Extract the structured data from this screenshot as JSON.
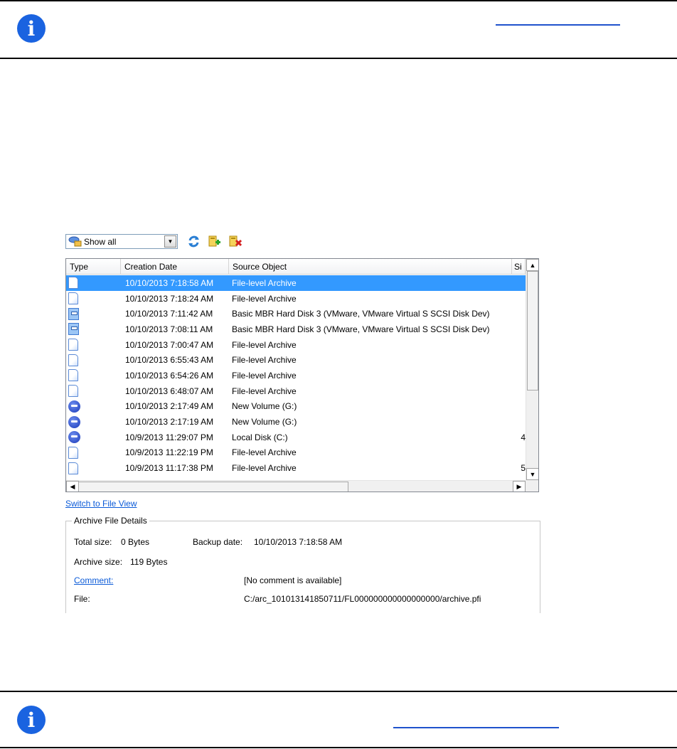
{
  "combo": {
    "value": "Show all",
    "icon": "filter-icon"
  },
  "toolbar": {
    "icons": [
      "refresh-icon",
      "add-archive-icon",
      "delete-archive-icon"
    ]
  },
  "table": {
    "columns": [
      "Type",
      "Creation Date",
      "Source Object",
      "Si"
    ],
    "sort": {
      "column": "Creation Date",
      "direction": "descending"
    },
    "rows": [
      {
        "icon": "file-icon",
        "date": "10/10/2013 7:18:58 AM",
        "source": "File-level Archive",
        "size": ""
      },
      {
        "icon": "file-icon",
        "date": "10/10/2013 7:18:24 AM",
        "source": "File-level Archive",
        "size": ""
      },
      {
        "icon": "disk-icon",
        "date": "10/10/2013 7:11:42 AM",
        "source": "Basic MBR Hard Disk 3 (VMware, VMware Virtual S SCSI Disk Dev)",
        "size": ""
      },
      {
        "icon": "disk-icon",
        "date": "10/10/2013 7:08:11 AM",
        "source": "Basic MBR Hard Disk 3 (VMware, VMware Virtual S SCSI Disk Dev)",
        "size": ""
      },
      {
        "icon": "file-icon",
        "date": "10/10/2013 7:00:47 AM",
        "source": "File-level Archive",
        "size": ""
      },
      {
        "icon": "file-icon",
        "date": "10/10/2013 6:55:43 AM",
        "source": "File-level Archive",
        "size": ""
      },
      {
        "icon": "file-icon",
        "date": "10/10/2013 6:54:26 AM",
        "source": "File-level Archive",
        "size": ""
      },
      {
        "icon": "file-icon",
        "date": "10/10/2013 6:48:07 AM",
        "source": "File-level Archive",
        "size": ""
      },
      {
        "icon": "volume-icon",
        "date": "10/10/2013 2:17:49 AM",
        "source": "New Volume (G:)",
        "size": ""
      },
      {
        "icon": "volume-icon",
        "date": "10/10/2013 2:17:19 AM",
        "source": "New Volume (G:)",
        "size": ""
      },
      {
        "icon": "volume-icon",
        "date": "10/9/2013 11:29:07 PM",
        "source": "Local Disk (C:)",
        "size": "4"
      },
      {
        "icon": "file-icon",
        "date": "10/9/2013 11:22:19 PM",
        "source": "File-level Archive",
        "size": ""
      },
      {
        "icon": "file-icon",
        "date": "10/9/2013 11:17:38 PM",
        "source": "File-level Archive",
        "size": "5"
      }
    ],
    "selected_row": 0
  },
  "switch_link": "Switch to File View",
  "details": {
    "legend": "Archive File Details",
    "total_size_label": "Total size:",
    "total_size_value": "0 Bytes",
    "backup_date_label": "Backup date:",
    "backup_date_value": "10/10/2013 7:18:58 AM",
    "archive_size_label": "Archive size:",
    "archive_size_value": "119 Bytes",
    "comment_label": "Comment:",
    "comment_value": "[No comment is available]",
    "file_label": "File:",
    "file_value": "C:/arc_101013141850711/FL000000000000000000/archive.pfi"
  },
  "colors": {
    "selection": "#3399ff",
    "link": "#0a5ad8",
    "info_icon": "#1a63e0"
  }
}
